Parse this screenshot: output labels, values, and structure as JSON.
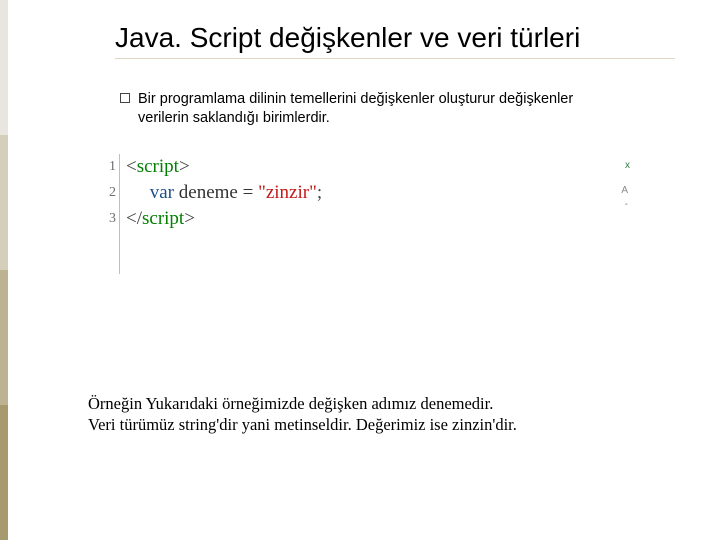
{
  "title": "Java. Script değişkenler ve veri türleri",
  "bullet": {
    "text": "Bir programlama dilinin temellerini değişkenler oluşturur değişkenler verilerin saklandığı birimlerdir."
  },
  "code": {
    "line_numbers": [
      "1",
      "2",
      "3"
    ],
    "l1": {
      "open": "<",
      "tag": "script",
      "close": ">"
    },
    "l2": {
      "kw": "var",
      "id": "deneme",
      "eq": "=",
      "str": "\"zinzir\"",
      "semi": ";"
    },
    "l3": {
      "open": "</",
      "tag": "script",
      "close": ">"
    },
    "corner_x": "x",
    "rside": {
      "a": "A",
      "dash": "-"
    }
  },
  "explanation": {
    "line1": "Örneğin Yukarıdaki örneğimizde değişken adımız denemedir.",
    "line2": "Veri  türümüz string'dir yani metinseldir.  Değerimiz ise zinzin'dir."
  }
}
